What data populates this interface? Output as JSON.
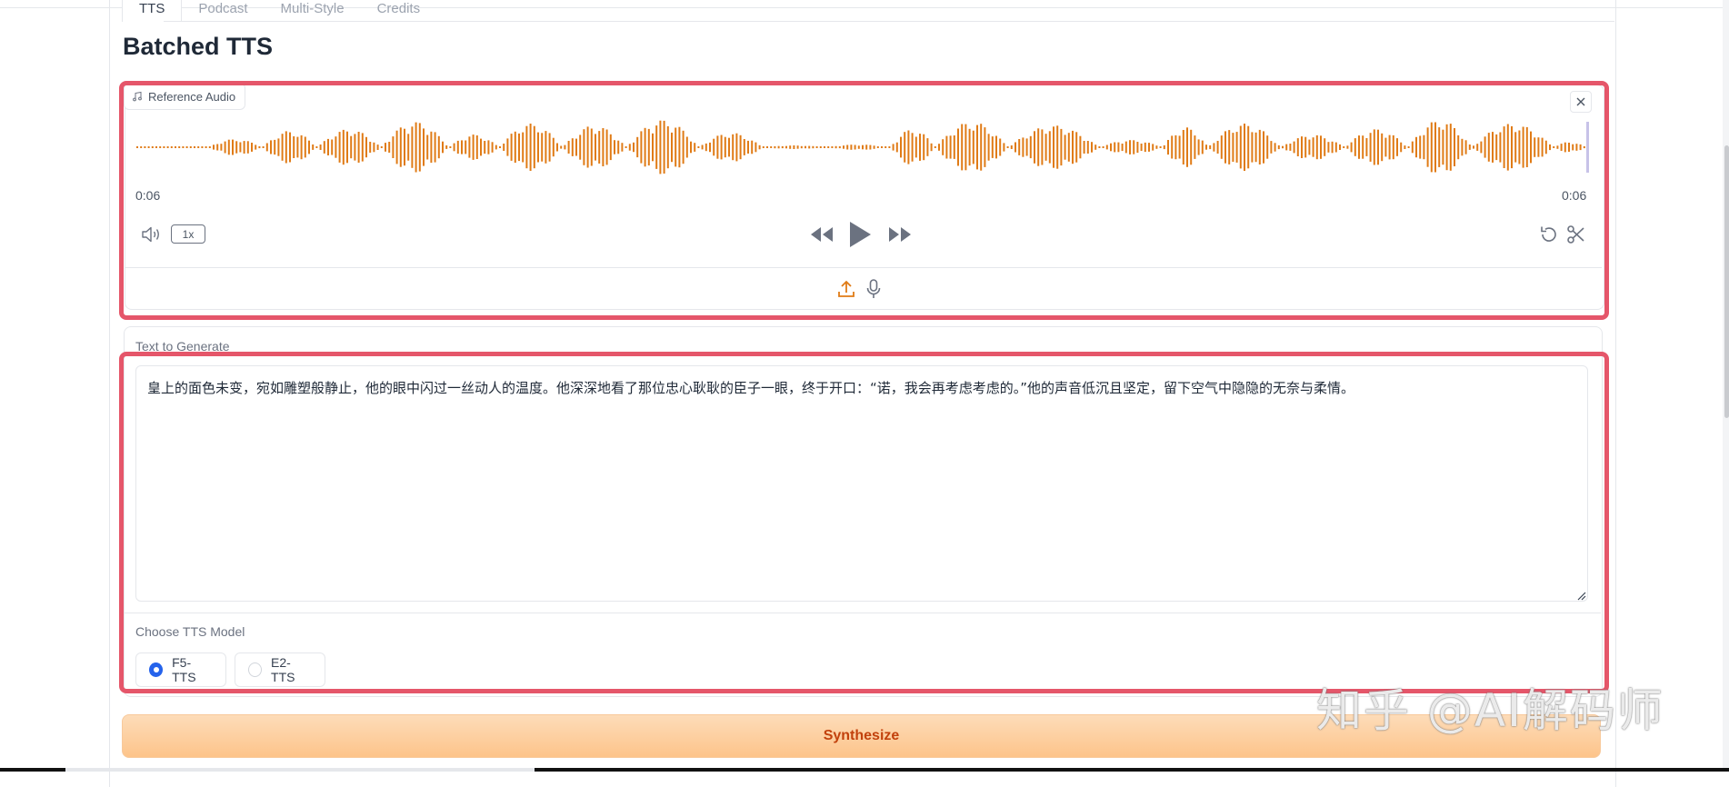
{
  "tabs": [
    {
      "label": "TTS",
      "active": true
    },
    {
      "label": "Podcast",
      "active": false
    },
    {
      "label": "Multi-Style",
      "active": false
    },
    {
      "label": "Credits",
      "active": false
    }
  ],
  "page_title": "Batched TTS",
  "reference_audio": {
    "label": "Reference Audio",
    "current_time": "0:06",
    "duration": "0:06",
    "speed": "1x",
    "waveform_color": "#e07b16"
  },
  "text_input": {
    "label": "Text to Generate",
    "value": "皇上的面色未变，宛如雕塑般静止，他的眼中闪过一丝动人的温度。他深深地看了那位忠心耿耿的臣子一眼，终于开口：“诺，我会再考虑考虑的。”他的声音低沉且坚定，留下空气中隐隐的无奈与柔情。"
  },
  "model_choice": {
    "label": "Choose TTS Model",
    "options": [
      {
        "label": "F5-TTS",
        "checked": true
      },
      {
        "label": "E2-TTS",
        "checked": false
      }
    ]
  },
  "synthesize_label": "Synthesize",
  "watermark": "知乎 @AI解码师",
  "colors": {
    "accent": "#2563eb",
    "highlight": "#e5566a",
    "button_text": "#c2410c"
  }
}
